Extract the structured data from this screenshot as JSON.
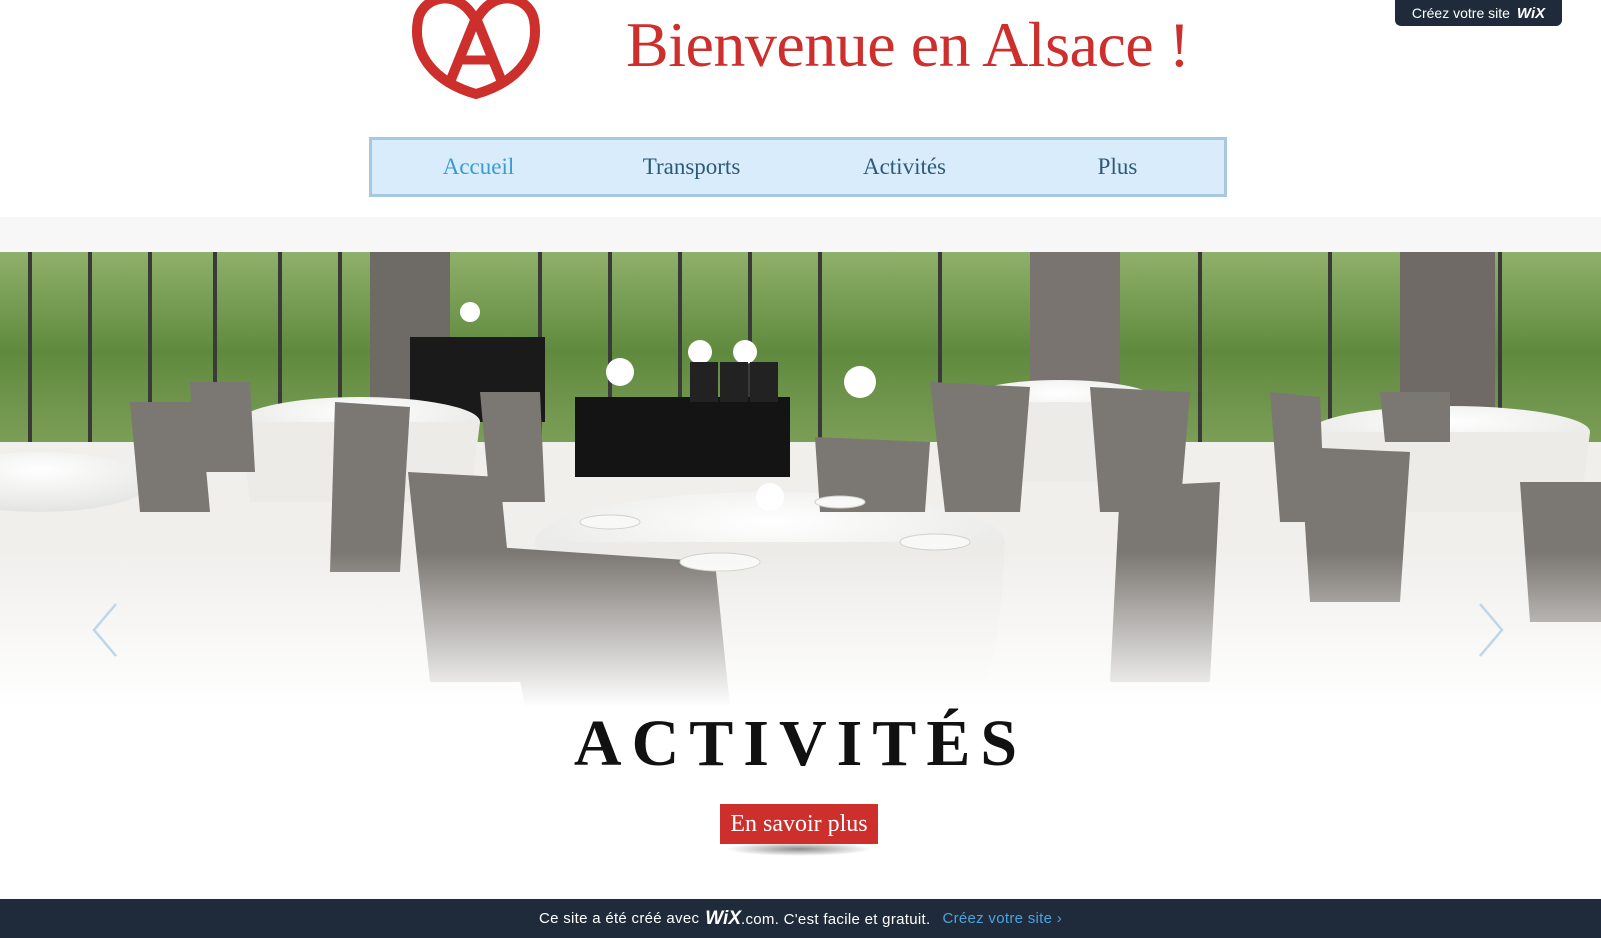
{
  "header": {
    "title": "Bienvenue en Alsace !",
    "logo_icon": "alsace-heart-a-logo",
    "wix_badge": {
      "text": "Créez votre site",
      "brand": "WiX"
    }
  },
  "nav": {
    "items": [
      {
        "label": "Accueil",
        "active": true
      },
      {
        "label": "Transports"
      },
      {
        "label": "Activités"
      },
      {
        "label": "Plus"
      }
    ]
  },
  "hero": {
    "image_subject": "restaurant-dining-room-photo",
    "prev_icon": "chevron-left-icon",
    "next_icon": "chevron-right-icon"
  },
  "section": {
    "heading": "ACTIVITÉS",
    "cta_label": "En savoir plus"
  },
  "footer": {
    "text_before": "Ce site a été créé avec",
    "brand": "WiX",
    "text_after": ".com. C'est facile et gratuit.",
    "link": "Créez votre site ›"
  },
  "colors": {
    "brand_red": "#cc2f2c",
    "nav_bg": "#d9ecfb",
    "nav_border": "#a7c8e0",
    "nav_active": "#3a9bcf",
    "footer_bg": "#1f2b3a",
    "footer_link": "#4aa3df"
  }
}
